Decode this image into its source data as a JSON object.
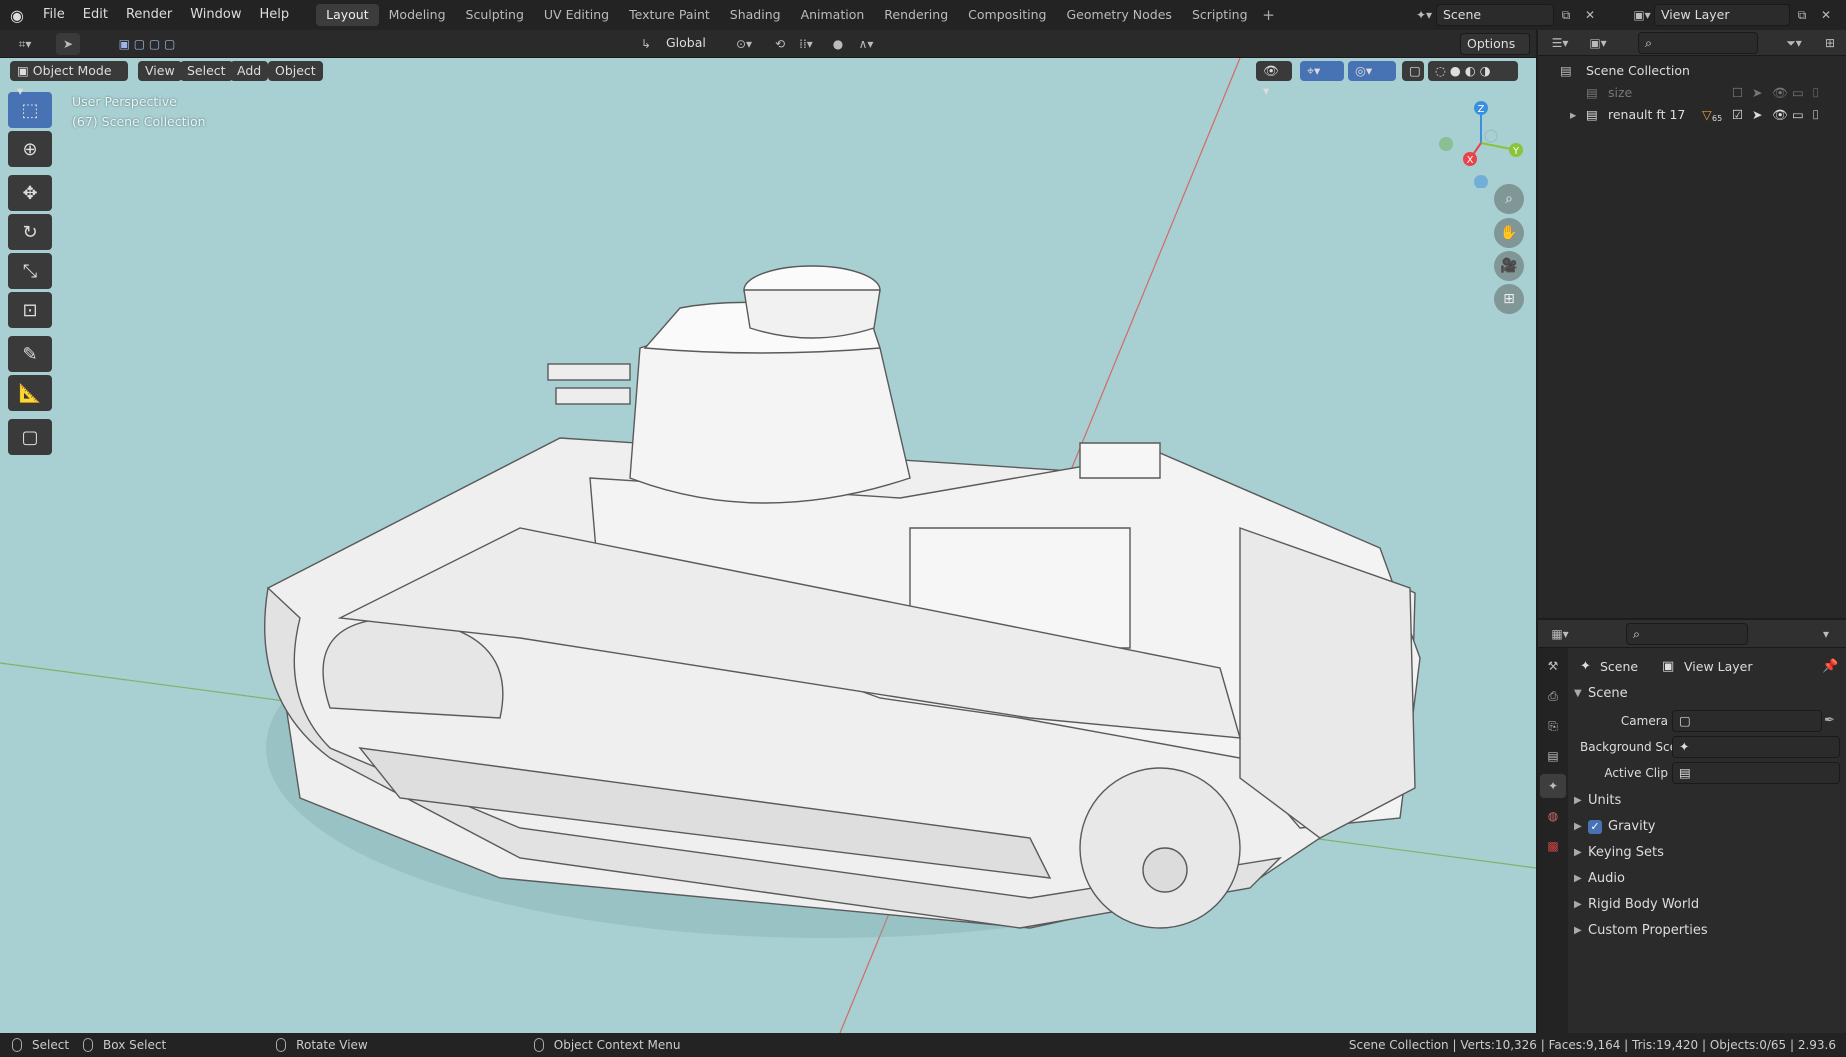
{
  "menu": {
    "file": "File",
    "edit": "Edit",
    "render": "Render",
    "window": "Window",
    "help": "Help"
  },
  "workspaces": [
    "Layout",
    "Modeling",
    "Sculpting",
    "UV Editing",
    "Texture Paint",
    "Shading",
    "Animation",
    "Rendering",
    "Compositing",
    "Geometry Nodes",
    "Scripting"
  ],
  "workspace_add": "+",
  "scene": {
    "name": "Scene"
  },
  "view_layer": {
    "name": "View Layer"
  },
  "viewport_header": {
    "orientation": "Global",
    "options": "Options"
  },
  "viewport_header2": {
    "mode": "Object Mode",
    "view": "View",
    "select": "Select",
    "add": "Add",
    "object": "Object"
  },
  "viewport": {
    "perspective": "User Perspective",
    "collection": "(67) Scene Collection"
  },
  "gizmo": {
    "z": "Z",
    "y": "Y",
    "x": "X"
  },
  "outliner": {
    "root": "Scene Collection",
    "items": [
      {
        "name": "size"
      },
      {
        "name": "renault ft 17",
        "count": "65"
      }
    ]
  },
  "properties": {
    "breadcrumb_scene": "Scene",
    "breadcrumb_layer": "View Layer",
    "section": "Scene",
    "camera_label": "Camera",
    "bg_label": "Background Sce...",
    "clip_label": "Active Clip",
    "subsections": [
      "Units",
      "Gravity",
      "Keying Sets",
      "Audio",
      "Rigid Body World",
      "Custom Properties"
    ]
  },
  "statusbar": {
    "select": "Select",
    "box_select": "Box Select",
    "rotate": "Rotate View",
    "context": "Object Context Menu",
    "stats": "Scene Collection | Verts:10,326 | Faces:9,164 | Tris:19,420 | Objects:0/65 | 2.93.6"
  },
  "colors": {
    "accent": "#4772b3",
    "viewport_bg": "#a8cfd1",
    "axis_x": "#e8434d",
    "axis_y": "#8bc33a",
    "axis_z": "#3b8fe0"
  }
}
